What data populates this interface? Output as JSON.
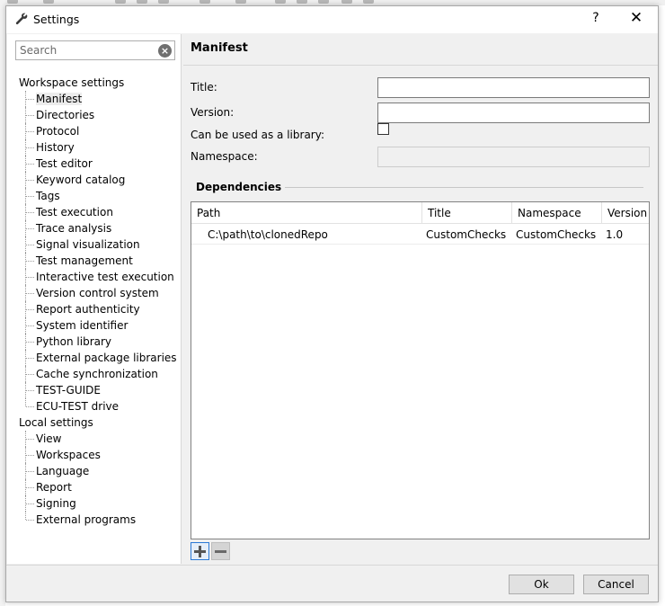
{
  "window": {
    "title": "Settings",
    "help_label": "?",
    "close_label": "✕"
  },
  "sidebar": {
    "search": {
      "placeholder": "Search"
    },
    "groups": [
      {
        "label": "Workspace settings",
        "items": [
          "Manifest",
          "Directories",
          "Protocol",
          "History",
          "Test editor",
          "Keyword catalog",
          "Tags",
          "Test execution",
          "Trace analysis",
          "Signal visualization",
          "Test management",
          "Interactive test execution",
          "Version control system",
          "Report authenticity",
          "System identifier",
          "Python library",
          "External package libraries",
          "Cache synchronization",
          "TEST-GUIDE",
          "ECU-TEST drive"
        ]
      },
      {
        "label": "Local settings",
        "items": [
          "View",
          "Workspaces",
          "Language",
          "Report",
          "Signing",
          "External programs"
        ]
      }
    ],
    "selected": "Manifest"
  },
  "main": {
    "heading": "Manifest",
    "fields": {
      "title_label": "Title:",
      "title_value": "",
      "version_label": "Version:",
      "version_value": "",
      "library_label": "Can be used as a library:",
      "library_checked": false,
      "namespace_label": "Namespace:",
      "namespace_value": ""
    },
    "dependencies": {
      "title": "Dependencies",
      "columns": [
        "Path",
        "Title",
        "Namespace",
        "Version"
      ],
      "rows": [
        {
          "path": "C:\\path\\to\\clonedRepo",
          "title": "CustomChecks",
          "namespace": "CustomChecks",
          "version": "1.0"
        }
      ]
    }
  },
  "footer": {
    "ok_label": "Ok",
    "cancel_label": "Cancel"
  },
  "colors": {
    "accent": "#2b79d6",
    "dialog_bg": "#f0f0f0",
    "selected_item_bg": "#ececec"
  },
  "icons": {
    "window": "wrench-icon",
    "search_clear": "clear-icon",
    "add": "plus-icon",
    "remove": "minus-icon"
  }
}
